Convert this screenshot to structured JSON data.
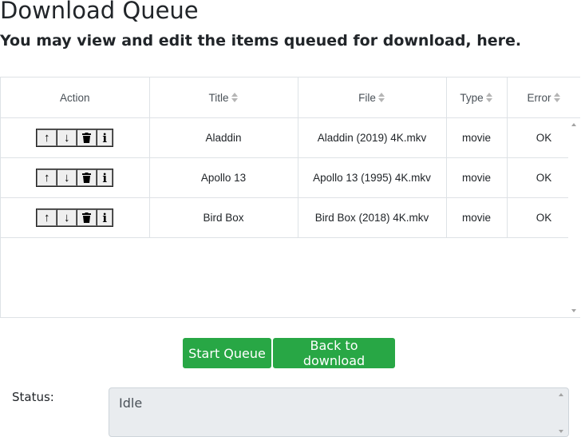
{
  "page": {
    "title": "Download Queue",
    "subtitle": "You may view and edit the items queued for download, here."
  },
  "table": {
    "headers": {
      "action": "Action",
      "title": "Title",
      "file": "File",
      "type": "Type",
      "error": "Error"
    },
    "action_icons": [
      "arrow-up-icon",
      "arrow-down-icon",
      "trash-icon",
      "info-icon"
    ],
    "rows": [
      {
        "title": "Aladdin",
        "file": "Aladdin (2019) 4K.mkv",
        "type": "movie",
        "error": "OK"
      },
      {
        "title": "Apollo 13",
        "file": "Apollo 13 (1995) 4K.mkv",
        "type": "movie",
        "error": "OK"
      },
      {
        "title": "Bird Box",
        "file": "Bird Box (2018) 4K.mkv",
        "type": "movie",
        "error": "OK"
      }
    ]
  },
  "buttons": {
    "start_queue": "Start Queue",
    "back_to_download": "Back to download"
  },
  "status": {
    "label": "Status:",
    "value": "Idle"
  },
  "colors": {
    "primary_button": "#28a745",
    "status_background": "#e9ecef",
    "table_border": "#dee2e6"
  }
}
